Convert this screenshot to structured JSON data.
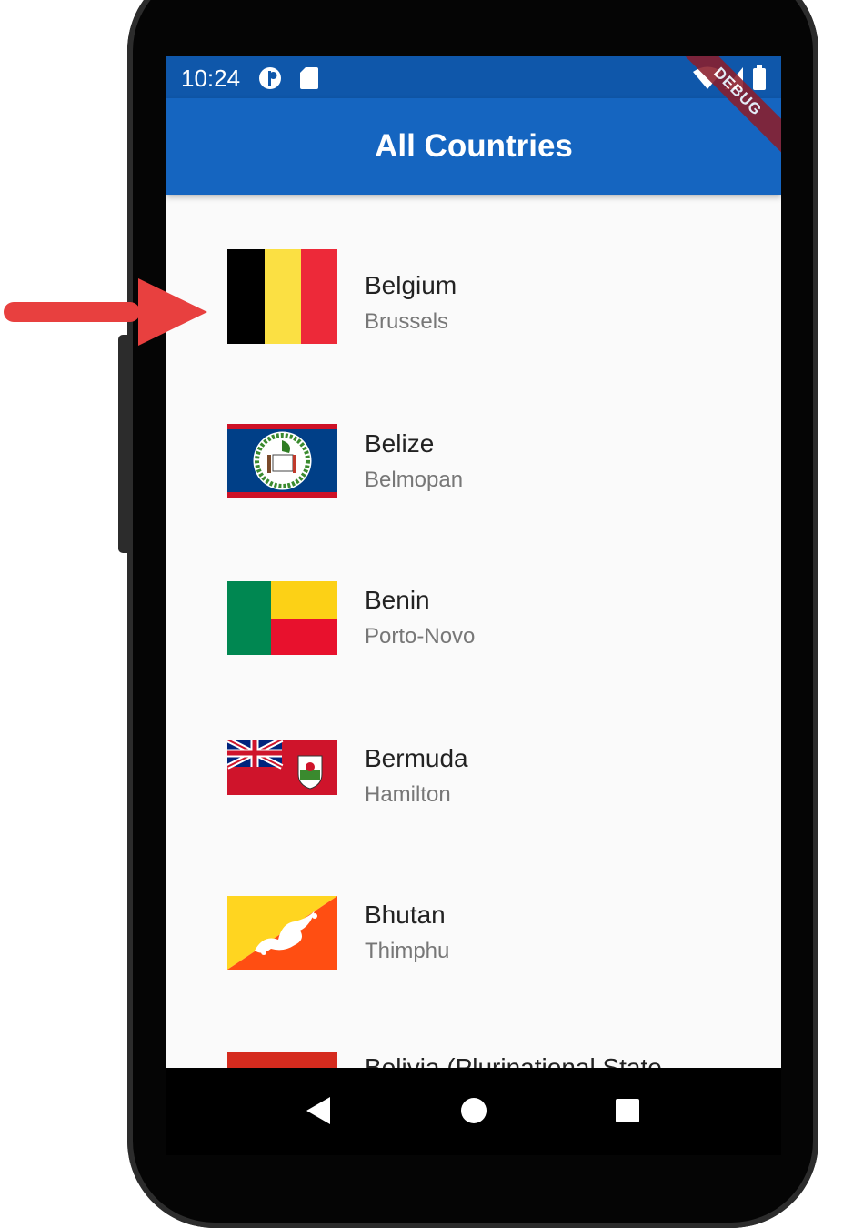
{
  "status_bar": {
    "time": "10:24",
    "debug_banner": "DEBUG"
  },
  "app_bar": {
    "title": "All Countries"
  },
  "countries": [
    {
      "name": "Belgium",
      "capital": "Brussels",
      "flag_icon": "belgium-flag-icon"
    },
    {
      "name": "Belize",
      "capital": "Belmopan",
      "flag_icon": "belize-flag-icon"
    },
    {
      "name": "Benin",
      "capital": "Porto-Novo",
      "flag_icon": "benin-flag-icon"
    },
    {
      "name": "Bermuda",
      "capital": "Hamilton",
      "flag_icon": "bermuda-flag-icon"
    },
    {
      "name": "Bhutan",
      "capital": "Thimphu",
      "flag_icon": "bhutan-flag-icon"
    },
    {
      "name": "Bolivia (Plurinational State",
      "capital": "",
      "flag_icon": "bolivia-flag-icon"
    }
  ],
  "nav_bar": {
    "buttons": [
      "back-icon",
      "home-icon",
      "recents-icon"
    ]
  },
  "colors": {
    "app_bar": "#1565c0",
    "status_bar": "#0f57aa",
    "background": "#fafafa",
    "annotation_arrow": "#e8403f"
  }
}
